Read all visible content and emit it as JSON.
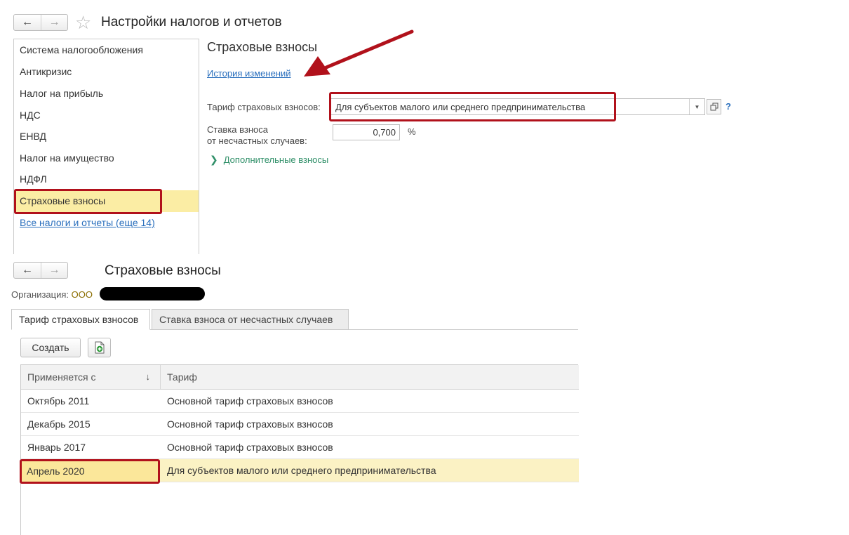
{
  "top_window": {
    "title": "Настройки налогов и отчетов",
    "nav": {
      "back_icon": "arrow-left-icon",
      "forward_icon": "arrow-right-icon",
      "favorite_icon": "star-icon"
    },
    "sidebar": {
      "items": [
        {
          "label": "Система налогообложения"
        },
        {
          "label": "Антикризис"
        },
        {
          "label": "Налог на прибыль"
        },
        {
          "label": "НДС"
        },
        {
          "label": "ЕНВД"
        },
        {
          "label": "Налог на имущество"
        },
        {
          "label": "НДФЛ"
        },
        {
          "label": "Страховые взносы",
          "active": true
        }
      ],
      "all_link": "Все налоги и отчеты (еще 14)"
    },
    "section": {
      "title": "Страховые взносы",
      "history_link": "История изменений",
      "tariff_label": "Тариф страховых взносов:",
      "tariff_value": "Для субъектов малого или среднего предпринимательства",
      "rate_label_line1": "Ставка взноса",
      "rate_label_line2": "от несчастных случаев:",
      "rate_value": "0,700",
      "rate_unit": "%",
      "help": "?",
      "extra_link": "Дополнительные взносы"
    }
  },
  "bottom_window": {
    "title": "Страховые взносы",
    "org_label": "Организация:",
    "org_value": "ООО",
    "tabs": [
      {
        "label": "Тариф страховых взносов",
        "active": true
      },
      {
        "label": "Ставка взноса от несчастных случаев",
        "active": false
      }
    ],
    "toolbar": {
      "create_label": "Создать",
      "copy_icon": "copy-add-icon"
    },
    "table": {
      "columns": [
        "Применяется с",
        "Тариф"
      ],
      "sort_indicator": "↓",
      "rows": [
        [
          "Октябрь 2011",
          "Основной тариф страховых взносов"
        ],
        [
          "Декабрь 2015",
          "Основной тариф страховых взносов"
        ],
        [
          "Январь 2017",
          "Основной тариф страховых взносов"
        ],
        [
          "Апрель 2020",
          "Для субъектов малого или среднего предпринимательства"
        ]
      ],
      "selected_row": 3
    }
  },
  "colors": {
    "accent_red": "#b1111b",
    "link_blue": "#2a6fbd",
    "active_yellow": "#fbeda4",
    "extra_green": "#2f8f68"
  }
}
